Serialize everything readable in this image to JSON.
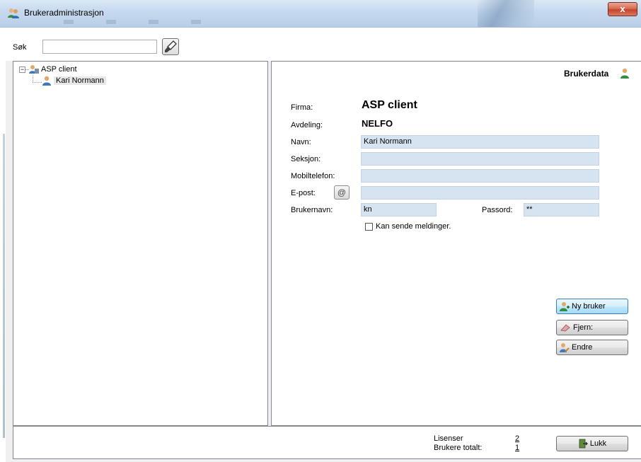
{
  "window": {
    "title": "Brukeradministrasjon",
    "close_glyph": "x"
  },
  "search": {
    "label": "Søk",
    "value": "",
    "placeholder": ""
  },
  "tree": {
    "root": {
      "label": "ASP client",
      "expander": "−"
    },
    "child": {
      "label": "Kari Normann"
    }
  },
  "details": {
    "header": "Brukerdata",
    "firma_label": "Firma:",
    "firma_value": "ASP client",
    "avdeling_label": "Avdeling:",
    "avdeling_value": "NELFO",
    "navn_label": "Navn:",
    "navn_value": "Kari Normann",
    "seksjon_label": "Seksjon:",
    "seksjon_value": "",
    "mobil_label": "Mobiltelefon:",
    "mobil_value": "",
    "epost_label": "E-post:",
    "epost_btn": "@",
    "epost_value": "",
    "brukernavn_label": "Brukernavn:",
    "brukernavn_value": "kn",
    "passord_label": "Passord:",
    "passord_value": "**",
    "kan_sende_label": "Kan sende meldinger.",
    "kan_sende_checked": false
  },
  "actions": {
    "ny_bruker": "Ny bruker",
    "fjern": "Fjern:",
    "endre": "Endre"
  },
  "footer": {
    "lisenser_label": "Lisenser",
    "lisenser_value": "2",
    "brukere_label": "Brukere totalt:",
    "brukere_value": "1",
    "lukk": "Lukk"
  },
  "colors": {
    "field_bg": "#d6e4f2",
    "title_bg": "#c5d8ee",
    "close_red": "#c4432b"
  },
  "icons": [
    "users-icon",
    "search-brush-icon",
    "company-icon",
    "user-icon",
    "at-icon",
    "add-user-icon",
    "eraser-icon",
    "edit-user-icon",
    "exit-door-icon"
  ]
}
